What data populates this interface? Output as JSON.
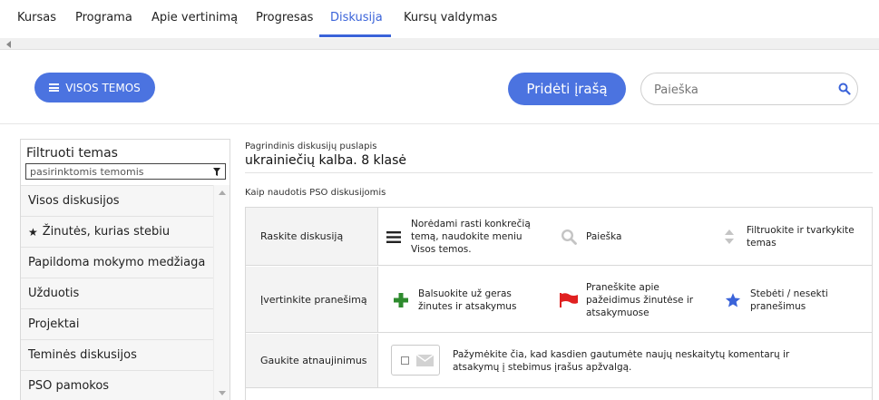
{
  "nav": {
    "tabs": [
      {
        "label": "Kursas"
      },
      {
        "label": "Programa"
      },
      {
        "label": "Apie vertinimą"
      },
      {
        "label": "Progresas"
      },
      {
        "label": "Diskusija"
      },
      {
        "label": "Kursų valdymas"
      }
    ],
    "active_tab": "Diskusija"
  },
  "toolbar": {
    "all_topics_label": "VISOS TEMOS",
    "add_post_label": "Pridėti įrašą",
    "search_placeholder": "Paieška"
  },
  "sidebar": {
    "filter_title": "Filtruoti temas",
    "filter_select_value": "pasirinktomis temomis",
    "items": [
      {
        "label": "Visos diskusijos"
      },
      {
        "label": "Žinutės, kurias stebiu",
        "icon": "star-icon"
      },
      {
        "label": "Papildoma mokymo medžiaga"
      },
      {
        "label": "Užduotis"
      },
      {
        "label": "Projektai"
      },
      {
        "label": "Teminės diskusijos"
      },
      {
        "label": "PSO pamokos"
      }
    ]
  },
  "main": {
    "breadcrumb": "Pagrindinis diskusijų puslapis",
    "course_title": "ukrainiečių kalba. 8 klasė",
    "howto_title": "Kaip naudotis PSO diskusijomis",
    "howto_rows": [
      {
        "label": "Raskite diskusiją",
        "cells": [
          {
            "icon": "menu-icon",
            "text": "Norėdami rasti konkrečią temą, naudokite meniu Visos temos."
          },
          {
            "icon": "search-icon",
            "text": "Paieška"
          },
          {
            "icon": "sort-icon",
            "text": "Filtruokite ir tvarkykite temas"
          }
        ]
      },
      {
        "label": "Įvertinkite pranešimą",
        "cells": [
          {
            "icon": "plus-icon",
            "text": "Balsuokite už geras žinutes ir atsakymus"
          },
          {
            "icon": "flag-icon",
            "text": "Praneškite apie pažeidimus žinutėse ir atsakymuose"
          },
          {
            "icon": "star-icon",
            "text": "Stebėti / nesekti pranešimus"
          }
        ]
      },
      {
        "label": "Gaukite atnaujinimus",
        "subscribe_text": "Pažymėkite čia, kad kasdien gautumėte naujų neskaitytų komentarų ir atsakymų į stebimus įrašus apžvalgą."
      }
    ]
  },
  "colors": {
    "accent": "#4b73e0",
    "active_tab": "#3a63d9",
    "plus": "#2e8b2e",
    "flag": "#e02020",
    "star": "#3a63d9"
  }
}
